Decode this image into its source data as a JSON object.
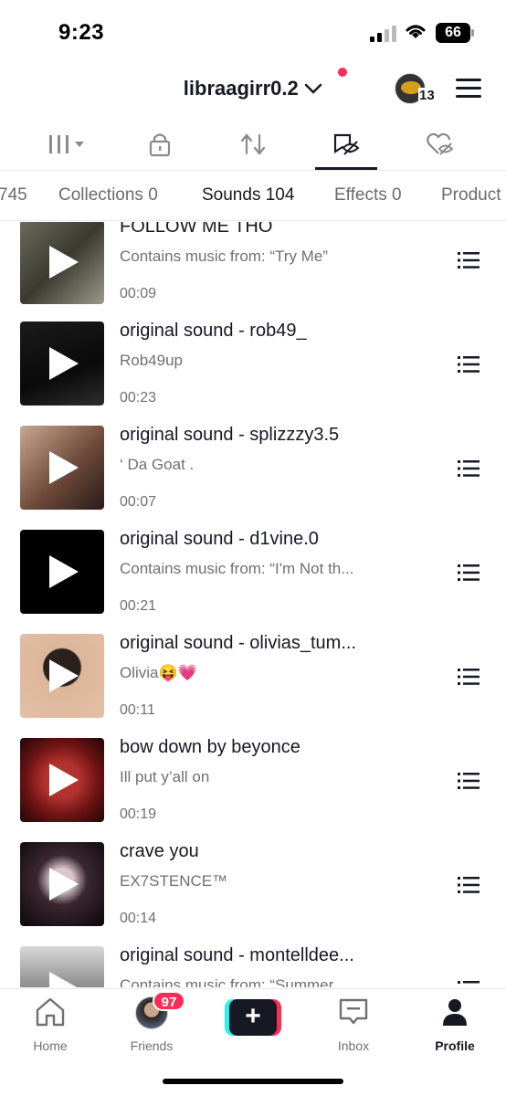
{
  "status_bar": {
    "time": "9:23",
    "battery": "66"
  },
  "header": {
    "username": "libraagirr0.2",
    "avatar_badge_count": "13"
  },
  "icon_tabs": [
    {
      "name": "grid-icon"
    },
    {
      "name": "lock-icon"
    },
    {
      "name": "repost-icon"
    },
    {
      "name": "saved-icon"
    },
    {
      "name": "liked-icon"
    }
  ],
  "tabs": {
    "partial": "745",
    "collections": "Collections 0",
    "sounds": "Sounds 104",
    "effects": "Effects 0",
    "products": "Product"
  },
  "sounds": [
    {
      "title": "FOLLOW ME THO",
      "subtitle": "Contains music from: “Try Me”",
      "duration": "00:09"
    },
    {
      "title": "original sound - rob49_",
      "subtitle": "Rob49up",
      "duration": "00:23"
    },
    {
      "title": "original sound - splizzzy3.5",
      "subtitle": "‘ Da Goat .",
      "duration": "00:07"
    },
    {
      "title": "original sound - d1vine.0",
      "subtitle": "Contains music from: “I'm Not th...",
      "duration": "00:21"
    },
    {
      "title": "original sound - olivias_tum...",
      "subtitle": "Olivia😝💗",
      "duration": "00:11"
    },
    {
      "title": "bow down by beyonce",
      "subtitle": "Ill  put  y’all  on",
      "duration": "00:19"
    },
    {
      "title": "crave you",
      "subtitle": "EX7STENCE™",
      "duration": "00:14"
    },
    {
      "title": "original sound - montelldee...",
      "subtitle": "Contains music from: “Summer...",
      "duration": ""
    }
  ],
  "bottom_nav": {
    "home": "Home",
    "friends": "Friends",
    "friends_badge": "97",
    "inbox": "Inbox",
    "profile": "Profile"
  }
}
